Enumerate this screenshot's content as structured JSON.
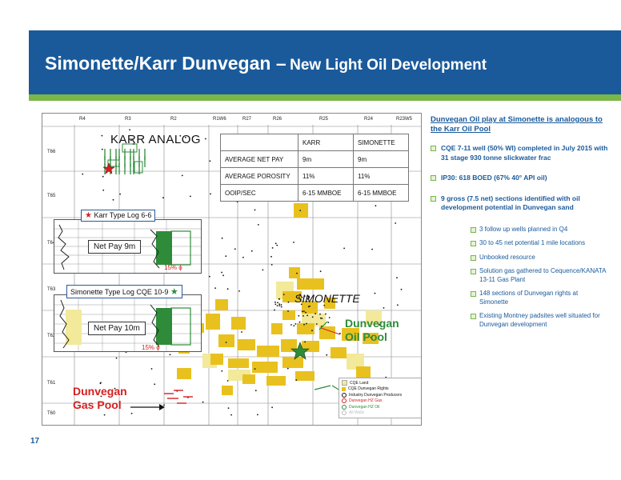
{
  "header": {
    "title_main": "Simonette/Karr Dunvegan –",
    "title_sub": "New Light Oil Development"
  },
  "map": {
    "ranges": [
      "R4",
      "R3",
      "R2",
      "R1W6",
      "R27",
      "R26",
      "R25",
      "R24",
      "R23W5"
    ],
    "townships": [
      "T66",
      "T65",
      "T64",
      "T63",
      "T62",
      "T61",
      "T60"
    ],
    "karr_analog": "KARR ANALOG",
    "simonette": "SIMONETTE",
    "oil_pool": "Dunvegan Oil Pool",
    "gas_pool": "Dunvegan Gas Pool",
    "karr_log_label": "Karr Type Log 6-6",
    "karr_netpay": "Net Pay 9m",
    "karr_pct": "15% ϕ",
    "sim_log_label": "Simonette Type Log CQE 10-9",
    "sim_netpay": "Net Pay 10m",
    "sim_pct": "15% ϕ",
    "legend": [
      {
        "label": "CQE Land",
        "color": "#f3e99a"
      },
      {
        "label": "CQE Dunvegan Rights",
        "color": "#e8c11f"
      },
      {
        "label": "Industry Dunvegan Producers",
        "color": "#111111"
      },
      {
        "label": "Dunvegan HZ Gas",
        "color": "#d42020"
      },
      {
        "label": "Dunvegan HZ Oil",
        "color": "#2e8b3a"
      },
      {
        "label": "All Wells",
        "color": "#bbbbbb"
      }
    ]
  },
  "comparison": {
    "headers": [
      "",
      "KARR",
      "SIMONETTE"
    ],
    "rows": [
      {
        "label": "AVERAGE NET PAY",
        "karr": "9m",
        "simonette": "9m"
      },
      {
        "label": "AVERAGE POROSITY",
        "karr": "11%",
        "simonette": "11%"
      },
      {
        "label": "OOIP/SEC",
        "karr": "6-15 MMBOE",
        "simonette": "6-15 MMBOE"
      }
    ]
  },
  "panel": {
    "heading": "Dunvegan Oil play at Simonette is analogous to the Karr Oil Pool",
    "bullets": [
      "CQE 7-11 well (50% WI) completed in July 2015 with 31 stage 930 tonne slickwater frac",
      "IP30: 618 BOED (67% 40° API oil)",
      "9 gross (7.5 net) sections identified with oil development potential in Dunvegan sand"
    ],
    "sub_bullets": [
      "3 follow up wells planned in Q4",
      "30 to 45 net potential 1 mile locations",
      "Unbooked resource",
      "Solution gas gathered to Cequence/KANATA 13-11 Gas Plant",
      "148 sections of Dunvegan rights at Simonette",
      "Existing Montney padsites well situated for Dunvegan development"
    ]
  },
  "footer": {
    "page_number": "17"
  },
  "colors": {
    "header_blue": "#1a5a9a",
    "accent_green": "#7ab648",
    "land_yellow": "#e8c11f",
    "oil_green": "#2e8b3a",
    "gas_red": "#d42020"
  }
}
